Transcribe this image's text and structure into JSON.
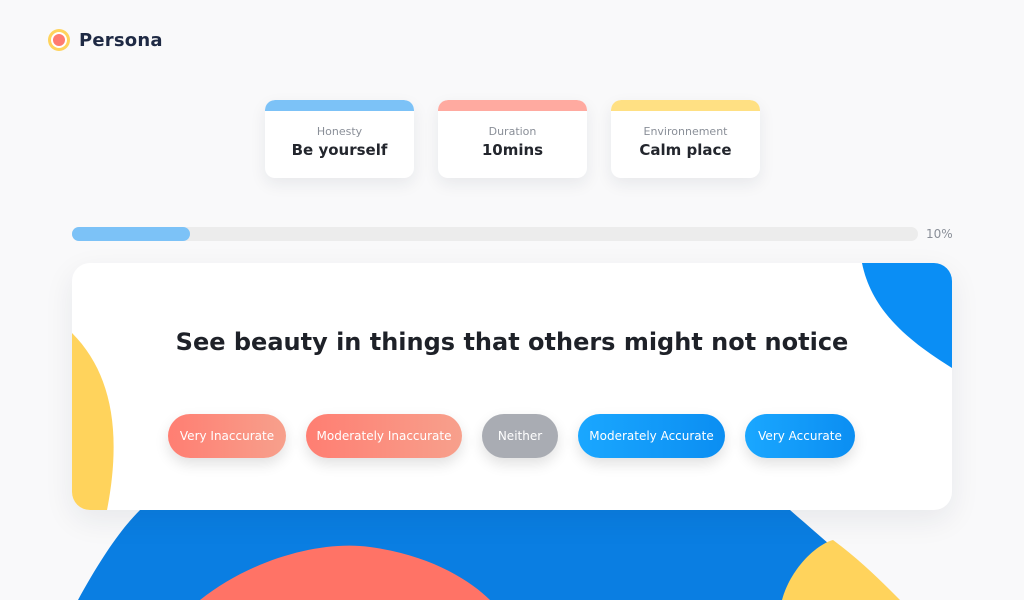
{
  "app": {
    "brand": "Persona"
  },
  "info_cards": [
    {
      "label": "Honesty",
      "value": "Be yourself",
      "accent": "#7cc2f7"
    },
    {
      "label": "Duration",
      "value": "10mins",
      "accent": "#ffaaa0"
    },
    {
      "label": "Environnement",
      "value": "Calm place",
      "accent": "#ffe083"
    }
  ],
  "progress": {
    "percent": 10,
    "label": "10%"
  },
  "question": {
    "text": "See beauty in things that others might not notice"
  },
  "answers": [
    {
      "label": "Very Inaccurate"
    },
    {
      "label": "Moderately Inaccurate"
    },
    {
      "label": "Neither"
    },
    {
      "label": "Moderately Accurate"
    },
    {
      "label": "Very Accurate"
    }
  ],
  "colors": {
    "blue": "#0a86ea",
    "coral": "#ff7366",
    "yellow": "#ffd35c"
  }
}
